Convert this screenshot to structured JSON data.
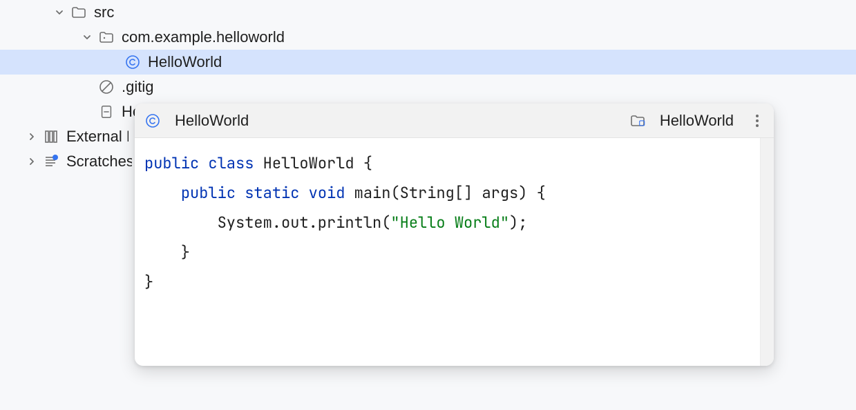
{
  "tree": {
    "src": "src",
    "package": "com.example.helloworld",
    "class": "HelloWorld",
    "gitignore": ".gitignore",
    "hello_truncated": "HelloWorld",
    "external": "External Libraries",
    "scratches": "Scratches and Consoles"
  },
  "preview": {
    "title": "HelloWorld",
    "breadcrumb": "HelloWorld",
    "code": {
      "kw_public1": "public",
      "kw_class": "class",
      "class_decl": " HelloWorld {",
      "indent1": "    ",
      "kw_public2": "public",
      "kw_static": "static",
      "kw_void": "void",
      "main_sig": " main(String[] args) {",
      "indent2": "        ",
      "println_pre": "System.out.println(",
      "str": "\"Hello World\"",
      "println_post": ");",
      "close1": "    }",
      "close2": "}"
    }
  }
}
